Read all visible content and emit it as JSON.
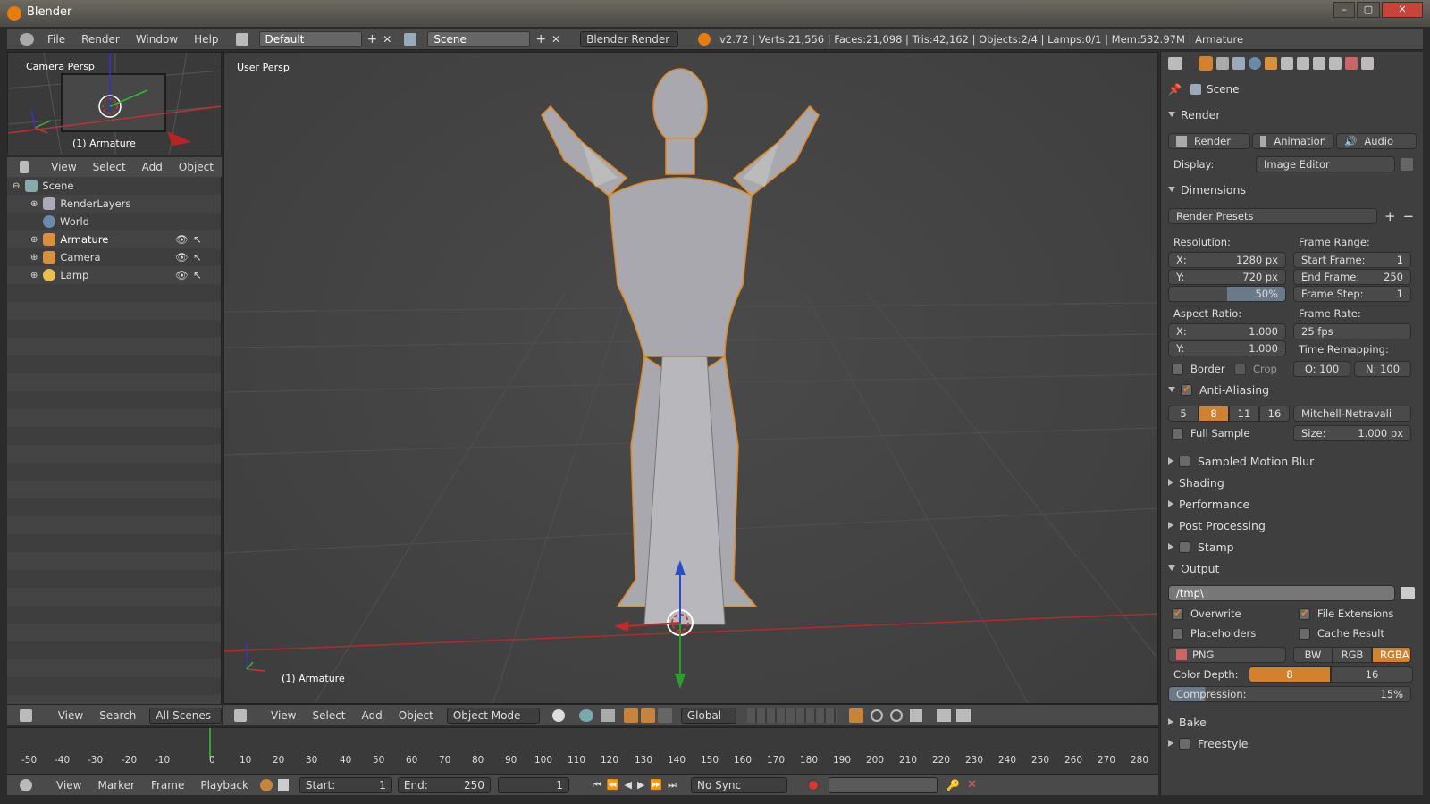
{
  "window": {
    "title": "Blender"
  },
  "info_header": {
    "menus": [
      "File",
      "Render",
      "Window",
      "Help"
    ],
    "layout": "Default",
    "scene": "Scene",
    "engine": "Blender Render",
    "stats": "v2.72 | Verts:21,556 | Faces:21,098 | Tris:42,162 | Objects:2/4 | Lamps:0/1 | Mem:532.97M | Armature"
  },
  "camera_view": {
    "label": "Camera Persp",
    "object": "(1) Armature"
  },
  "outliner": {
    "menus": [
      "View",
      "Select",
      "Add",
      "Object"
    ],
    "items": [
      {
        "label": "Scene",
        "indent": 0
      },
      {
        "label": "RenderLayers",
        "indent": 1
      },
      {
        "label": "World",
        "indent": 1
      },
      {
        "label": "Armature",
        "indent": 1
      },
      {
        "label": "Camera",
        "indent": 1
      },
      {
        "label": "Lamp",
        "indent": 1
      }
    ],
    "footer": {
      "view": "View",
      "search": "Search",
      "filter": "All Scenes"
    }
  },
  "viewport": {
    "label": "User Persp",
    "object": "(1) Armature",
    "header": {
      "menus": [
        "View",
        "Select",
        "Add",
        "Object"
      ],
      "mode": "Object Mode",
      "orientation": "Global"
    }
  },
  "timeline": {
    "ticks": [
      "-50",
      "-40",
      "-30",
      "-20",
      "-10",
      "0",
      "10",
      "20",
      "30",
      "40",
      "50",
      "60",
      "70",
      "80",
      "90",
      "100",
      "110",
      "120",
      "130",
      "140",
      "150",
      "160",
      "170",
      "180",
      "190",
      "200",
      "210",
      "220",
      "230",
      "240",
      "250",
      "260",
      "270",
      "280"
    ],
    "menus": [
      "View",
      "Marker",
      "Frame",
      "Playback"
    ],
    "start_label": "Start:",
    "start": "1",
    "end_label": "End:",
    "end": "250",
    "current": "1",
    "sync": "No Sync"
  },
  "properties": {
    "context": "Scene",
    "render": {
      "title": "Render",
      "buttons": [
        "Render",
        "Animation",
        "Audio"
      ],
      "display_label": "Display:",
      "display": "Image Editor"
    },
    "dimensions": {
      "title": "Dimensions",
      "presets": "Render Presets",
      "resolution_label": "Resolution:",
      "res_x": "X:",
      "res_x_val": "1280 px",
      "res_y": "Y:",
      "res_y_val": "720 px",
      "res_pct": "50%",
      "aspect_label": "Aspect Ratio:",
      "asp_x": "X:",
      "asp_x_val": "1.000",
      "asp_y": "Y:",
      "asp_y_val": "1.000",
      "border": "Border",
      "crop": "Crop",
      "frame_range_label": "Frame Range:",
      "start_frame": "Start Frame:",
      "start_frame_val": "1",
      "end_frame": "End Frame:",
      "end_frame_val": "250",
      "frame_step": "Frame Step:",
      "frame_step_val": "1",
      "frame_rate_label": "Frame Rate:",
      "frame_rate": "25 fps",
      "time_remap_label": "Time Remapping:",
      "remap_o": "O: 100",
      "remap_n": "N: 100"
    },
    "anti_aliasing": {
      "title": "Anti-Aliasing",
      "samples": [
        "5",
        "8",
        "11",
        "16"
      ],
      "selected": "8",
      "filter": "Mitchell-Netravali",
      "full_sample": "Full Sample",
      "size": "Size:",
      "size_val": "1.000 px"
    },
    "collapsed": [
      "Sampled Motion Blur",
      "Shading",
      "Performance",
      "Post Processing",
      "Stamp"
    ],
    "output": {
      "title": "Output",
      "path": "/tmp\\",
      "overwrite": "Overwrite",
      "file_extensions": "File Extensions",
      "placeholders": "Placeholders",
      "cache_result": "Cache Result",
      "format": "PNG",
      "color_modes": [
        "BW",
        "RGB",
        "RGBA"
      ],
      "color_mode_selected": "RGBA",
      "color_depth_label": "Color Depth:",
      "depths": [
        "8",
        "16"
      ],
      "depth_selected": "8",
      "compression_label": "Compression:",
      "compression_val": "15%",
      "compression_value": 15
    },
    "bottom_collapsed": [
      "Bake",
      "Freestyle"
    ]
  }
}
